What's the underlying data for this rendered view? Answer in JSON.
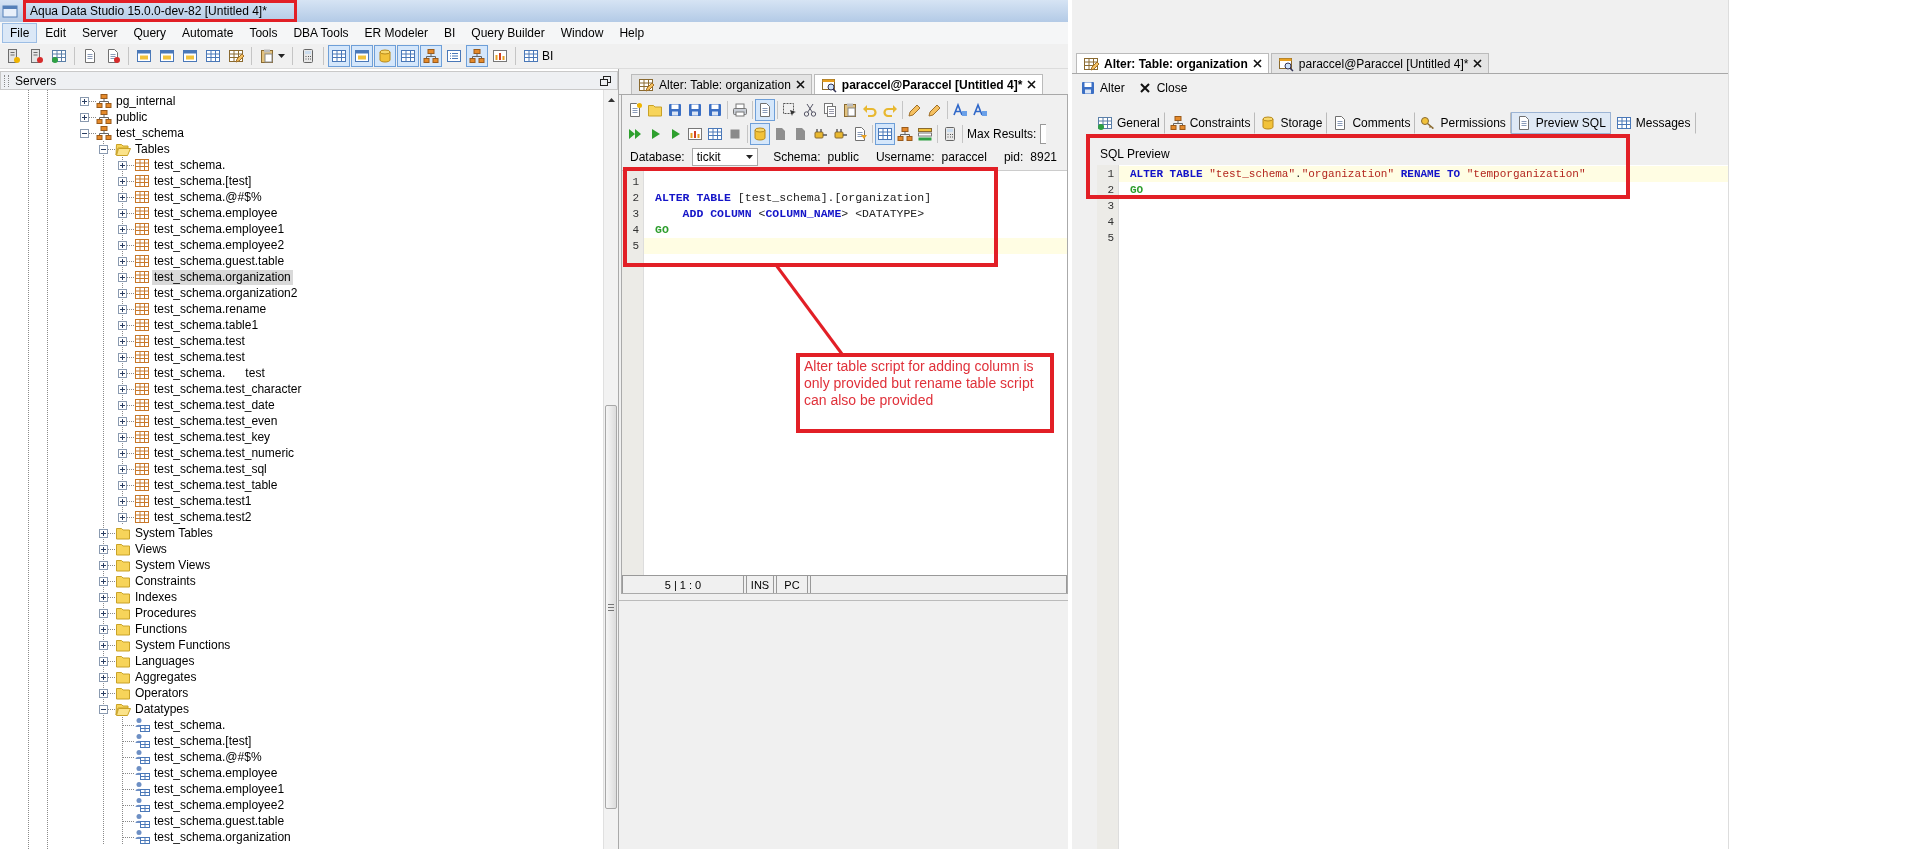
{
  "window": {
    "title": "Aqua Data Studio 15.0.0-dev-82 [Untitled 4]*"
  },
  "menu": [
    {
      "label": "File",
      "selected": true
    },
    {
      "label": "Edit",
      "selected": false
    },
    {
      "label": "Server",
      "selected": false
    },
    {
      "label": "Query",
      "selected": false
    },
    {
      "label": "Automate",
      "selected": false
    },
    {
      "label": "Tools",
      "selected": false
    },
    {
      "label": "DBA Tools",
      "selected": false
    },
    {
      "label": "ER Modeler",
      "selected": false
    },
    {
      "label": "BI",
      "selected": false
    },
    {
      "label": "Query Builder",
      "selected": false
    },
    {
      "label": "Window",
      "selected": false
    },
    {
      "label": "Help",
      "selected": false
    }
  ],
  "toolbar": [
    {
      "kind": "button",
      "pressed": false
    },
    {
      "kind": "button",
      "pressed": false
    },
    {
      "kind": "button",
      "pressed": false
    },
    {
      "kind": "button",
      "pressed": false
    },
    {
      "kind": "button",
      "pressed": false
    },
    {
      "kind": "button",
      "pressed": false
    },
    {
      "kind": "button",
      "pressed": false
    },
    {
      "kind": "button",
      "pressed": false
    },
    {
      "kind": "button",
      "pressed": false
    },
    {
      "kind": "button",
      "pressed": false
    },
    {
      "kind": "menu",
      "pressed": false
    },
    {
      "kind": "button",
      "pressed": false
    },
    {
      "kind": "button",
      "pressed": true
    },
    {
      "kind": "button",
      "pressed": true
    },
    {
      "kind": "button",
      "pressed": true
    },
    {
      "kind": "button",
      "pressed": true
    },
    {
      "kind": "button",
      "pressed": true
    },
    {
      "kind": "button",
      "pressed": false
    },
    {
      "kind": "button",
      "pressed": true
    },
    {
      "kind": "button",
      "pressed": false
    },
    {
      "kind": "button",
      "pressed": false,
      "label": "BI"
    }
  ],
  "servers_panel": {
    "title": "Servers",
    "tree": [
      {
        "label": "pg_internal",
        "kind": "schema",
        "expanded": false,
        "selected": false
      },
      {
        "label": "public",
        "kind": "schema",
        "expanded": false,
        "selected": false
      },
      {
        "label": "test_schema",
        "kind": "schema",
        "expanded": true,
        "selected": false,
        "children": [
          {
            "label": "Tables",
            "kind": "folder",
            "expanded": true,
            "selected": false,
            "children": [
              {
                "label": "test_schema.",
                "kind": "table",
                "expanded": false,
                "selected": false
              },
              {
                "label": "test_schema.[test]",
                "kind": "table",
                "expanded": false,
                "selected": false
              },
              {
                "label": "test_schema.@#$%",
                "kind": "table",
                "expanded": false,
                "selected": false
              },
              {
                "label": "test_schema.employee",
                "kind": "table",
                "expanded": false,
                "selected": false
              },
              {
                "label": "test_schema.employee1",
                "kind": "table",
                "expanded": false,
                "selected": false
              },
              {
                "label": "test_schema.employee2",
                "kind": "table",
                "expanded": false,
                "selected": false
              },
              {
                "label": "test_schema.guest.table",
                "kind": "table",
                "expanded": false,
                "selected": false
              },
              {
                "label": "test_schema.organization",
                "kind": "table",
                "expanded": false,
                "selected": true
              },
              {
                "label": "test_schema.organization2",
                "kind": "table",
                "expanded": false,
                "selected": false
              },
              {
                "label": "test_schema.rename",
                "kind": "table",
                "expanded": false,
                "selected": false
              },
              {
                "label": "test_schema.table1",
                "kind": "table",
                "expanded": false,
                "selected": false
              },
              {
                "label": "test_schema.test",
                "kind": "table",
                "expanded": false,
                "selected": false
              },
              {
                "label": "test_schema.test",
                "kind": "table",
                "expanded": false,
                "selected": false
              },
              {
                "label": "test_schema.      test",
                "kind": "table",
                "expanded": false,
                "selected": false
              },
              {
                "label": "test_schema.test_character",
                "kind": "table",
                "expanded": false,
                "selected": false
              },
              {
                "label": "test_schema.test_date",
                "kind": "table",
                "expanded": false,
                "selected": false
              },
              {
                "label": "test_schema.test_even",
                "kind": "table",
                "expanded": false,
                "selected": false
              },
              {
                "label": "test_schema.test_key",
                "kind": "table",
                "expanded": false,
                "selected": false
              },
              {
                "label": "test_schema.test_numeric",
                "kind": "table",
                "expanded": false,
                "selected": false
              },
              {
                "label": "test_schema.test_sql",
                "kind": "table",
                "expanded": false,
                "selected": false
              },
              {
                "label": "test_schema.test_table",
                "kind": "table",
                "expanded": false,
                "selected": false
              },
              {
                "label": "test_schema.test1",
                "kind": "table",
                "expanded": false,
                "selected": false
              },
              {
                "label": "test_schema.test2",
                "kind": "table",
                "expanded": false,
                "selected": false
              }
            ]
          },
          {
            "label": "System Tables",
            "kind": "folder",
            "expanded": false,
            "selected": false
          },
          {
            "label": "Views",
            "kind": "folder",
            "expanded": false,
            "selected": false
          },
          {
            "label": "System Views",
            "kind": "folder",
            "expanded": false,
            "selected": false
          },
          {
            "label": "Constraints",
            "kind": "folder",
            "expanded": false,
            "selected": false
          },
          {
            "label": "Indexes",
            "kind": "folder",
            "expanded": false,
            "selected": false
          },
          {
            "label": "Procedures",
            "kind": "folder",
            "expanded": false,
            "selected": false
          },
          {
            "label": "Functions",
            "kind": "folder",
            "expanded": false,
            "selected": false
          },
          {
            "label": "System Functions",
            "kind": "folder",
            "expanded": false,
            "selected": false
          },
          {
            "label": "Languages",
            "kind": "folder",
            "expanded": false,
            "selected": false
          },
          {
            "label": "Aggregates",
            "kind": "folder",
            "expanded": false,
            "selected": false
          },
          {
            "label": "Operators",
            "kind": "folder",
            "expanded": false,
            "selected": false
          },
          {
            "label": "Datatypes",
            "kind": "folder",
            "expanded": true,
            "selected": false,
            "children": [
              {
                "label": "test_schema.",
                "kind": "datatype",
                "selected": false
              },
              {
                "label": "test_schema.[test]",
                "kind": "datatype",
                "selected": false
              },
              {
                "label": "test_schema.@#$%",
                "kind": "datatype",
                "selected": false
              },
              {
                "label": "test_schema.employee",
                "kind": "datatype",
                "selected": false
              },
              {
                "label": "test_schema.employee1",
                "kind": "datatype",
                "selected": false
              },
              {
                "label": "test_schema.employee2",
                "kind": "datatype",
                "selected": false
              },
              {
                "label": "test_schema.guest.table",
                "kind": "datatype",
                "selected": false
              },
              {
                "label": "test_schema.organization",
                "kind": "datatype",
                "selected": false
              }
            ]
          }
        ]
      }
    ]
  },
  "editor_tabs": [
    {
      "label": "Alter: Table: organization",
      "selected": false
    },
    {
      "label": "paraccel@Paraccel [Untitled 4]*",
      "selected": true
    }
  ],
  "editor_toolbar": [
    [
      {
        "pressed": false
      },
      {
        "pressed": false
      },
      {
        "pressed": false
      },
      {
        "pressed": false
      },
      {
        "pressed": false
      },
      {
        "pressed": false
      },
      {
        "pressed": true
      },
      {
        "pressed": false
      },
      {
        "pressed": false
      },
      {
        "pressed": false
      },
      {
        "pressed": false
      },
      {
        "pressed": false
      },
      {
        "pressed": false
      },
      {
        "pressed": false
      },
      {
        "pressed": false
      },
      {
        "pressed": false
      },
      {
        "pressed": false
      }
    ],
    [
      {
        "pressed": false
      },
      {
        "pressed": false
      },
      {
        "pressed": false
      },
      {
        "pressed": false
      },
      {
        "pressed": false
      },
      {
        "pressed": false
      },
      {
        "pressed": true
      },
      {
        "pressed": false
      },
      {
        "pressed": false
      },
      {
        "pressed": false
      },
      {
        "pressed": false
      },
      {
        "pressed": false
      },
      {
        "pressed": true
      },
      {
        "pressed": false
      },
      {
        "pressed": false
      },
      {
        "pressed": false
      }
    ]
  ],
  "max_results_label": "Max Results:",
  "connection": {
    "database_label": "Database:",
    "database": "tickit",
    "fields": [
      {
        "label": "Schema:",
        "value": "public"
      },
      {
        "label": "Username:",
        "value": "paraccel"
      },
      {
        "label": "pid:",
        "value": "8921"
      }
    ]
  },
  "editor_lines": [
    {
      "number": "1",
      "current": false
    },
    {
      "number": "2",
      "current": false,
      "tokens": [
        {
          "text": "ALTER TABLE",
          "kind": "keyword"
        },
        {
          "text": " [test_schema].[organization]",
          "kind": "plain"
        }
      ]
    },
    {
      "number": "3",
      "current": false,
      "tokens": [
        {
          "text": "    ADD COLUMN",
          "kind": "keyword"
        },
        {
          "text": " <",
          "kind": "plain"
        },
        {
          "text": "COLUMN_NAME",
          "kind": "keyword"
        },
        {
          "text": "> <DATATYPE>",
          "kind": "plain"
        }
      ]
    },
    {
      "number": "4",
      "current": false,
      "tokens": [
        {
          "text": "GO",
          "kind": "terminator"
        }
      ]
    },
    {
      "number": "5",
      "current": true
    }
  ],
  "status_bar": [
    "5 | 1 : 0",
    "INS",
    "PC"
  ],
  "annotation": {
    "text": "Alter table script for adding column is only provided but rename table script can also be provided"
  },
  "alter_window": {
    "tabs": [
      {
        "label": "Alter: Table: organization",
        "selected": true
      },
      {
        "label": "paraccel@Paraccel [Untitled 4]*",
        "selected": false
      }
    ],
    "actions": [
      {
        "label": "Alter"
      },
      {
        "label": "Close"
      }
    ],
    "sections": [
      {
        "label": "General",
        "selected": false
      },
      {
        "label": "Constraints",
        "selected": false
      },
      {
        "label": "Storage",
        "selected": false
      },
      {
        "label": "Comments",
        "selected": false
      },
      {
        "label": "Permissions",
        "selected": false
      },
      {
        "label": "Preview SQL",
        "selected": true
      },
      {
        "label": "Messages",
        "selected": false
      }
    ],
    "preview_title": "SQL Preview",
    "lines": [
      {
        "number": "1",
        "current": true,
        "tokens": [
          {
            "text": "ALTER TABLE ",
            "kind": "keyword"
          },
          {
            "text": "\"test_schema\"",
            "kind": "string"
          },
          {
            "text": ".",
            "kind": "plain"
          },
          {
            "text": "\"organization\"",
            "kind": "string"
          },
          {
            "text": " RENAME TO ",
            "kind": "keyword"
          },
          {
            "text": "\"temporganization\"",
            "kind": "string"
          }
        ]
      },
      {
        "number": "2",
        "current": false,
        "tokens": [
          {
            "text": "GO",
            "kind": "terminator"
          }
        ]
      },
      {
        "number": "3",
        "current": false
      },
      {
        "number": "4",
        "current": false
      },
      {
        "number": "5",
        "current": false
      }
    ]
  }
}
